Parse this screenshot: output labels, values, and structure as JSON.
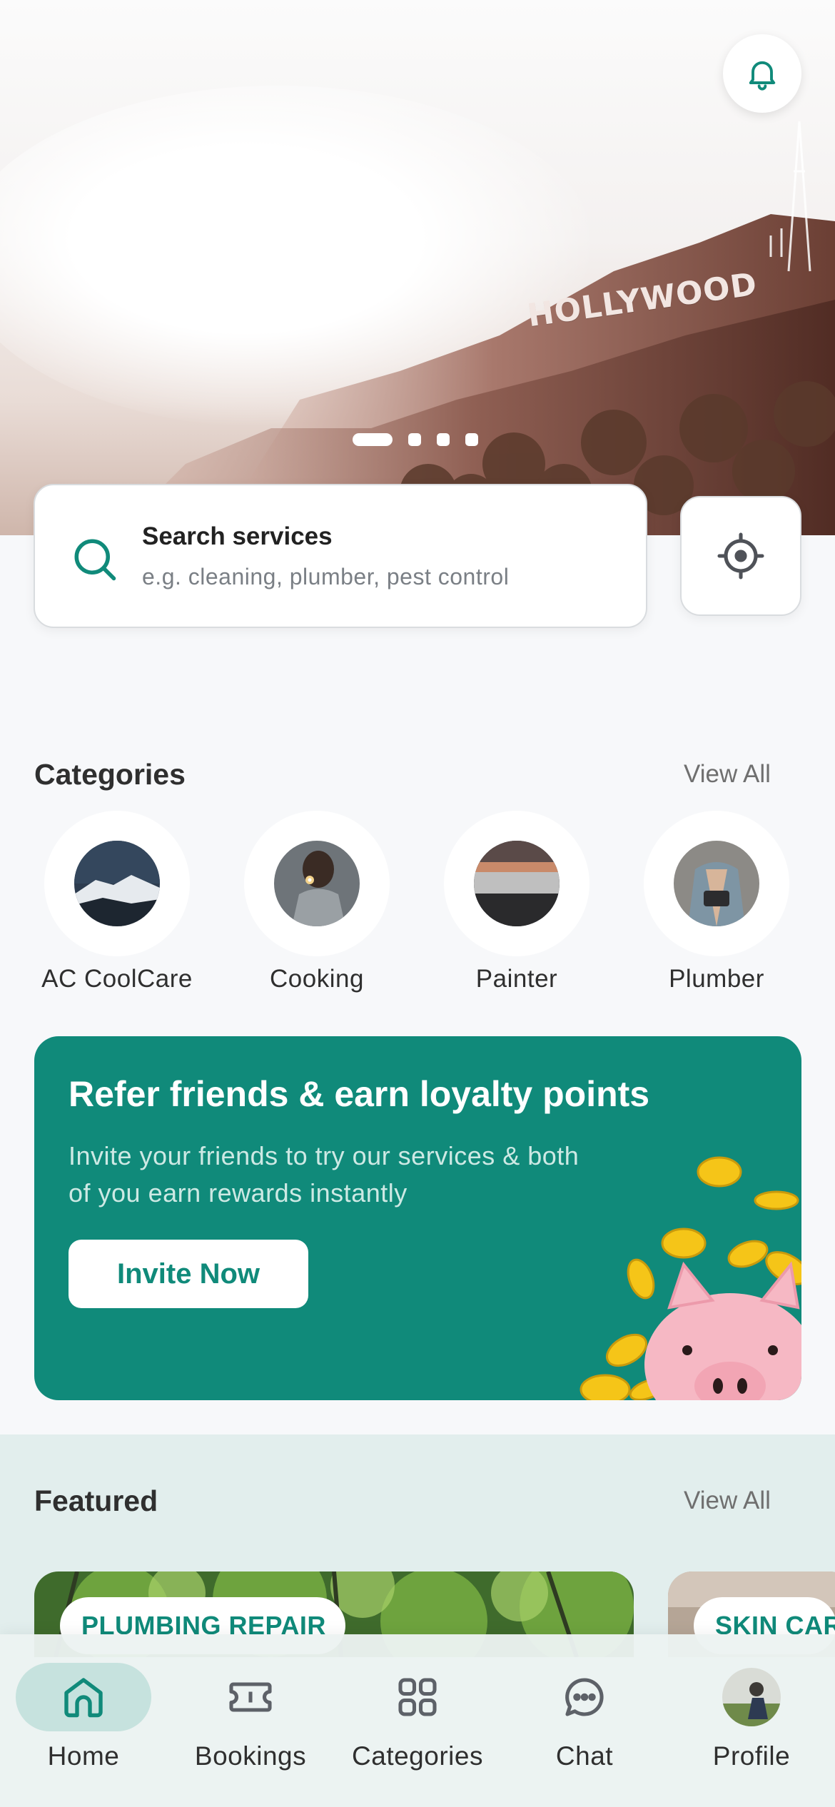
{
  "hero": {
    "sign_text": "HOLLYWOOD",
    "slide_count": 4,
    "active_slide": 1
  },
  "search": {
    "title": "Search services",
    "placeholder": "e.g. cleaning, plumber, pest control"
  },
  "categories": {
    "title": "Categories",
    "view_all": "View All",
    "items": [
      {
        "label": "AC CoolCare"
      },
      {
        "label": "Cooking"
      },
      {
        "label": "Painter"
      },
      {
        "label": "Plumber"
      }
    ]
  },
  "refer": {
    "title": "Refer friends & earn loyalty points",
    "subtitle": "Invite your friends to try our services & both of you earn rewards instantly",
    "button": "Invite Now"
  },
  "featured": {
    "title": "Featured",
    "view_all": "View All",
    "items": [
      {
        "label": "PLUMBING REPAIR"
      },
      {
        "label": "SKIN CARE"
      }
    ]
  },
  "nav": {
    "items": [
      {
        "label": "Home",
        "icon": "home-icon",
        "active": true
      },
      {
        "label": "Bookings",
        "icon": "ticket-icon"
      },
      {
        "label": "Categories",
        "icon": "grid-icon"
      },
      {
        "label": "Chat",
        "icon": "chat-icon"
      },
      {
        "label": "Profile",
        "icon": "avatar"
      }
    ]
  },
  "colors": {
    "brand": "#108a7a",
    "nav_active_bg": "#c6e2de",
    "featured_bg": "#e2eeed"
  }
}
